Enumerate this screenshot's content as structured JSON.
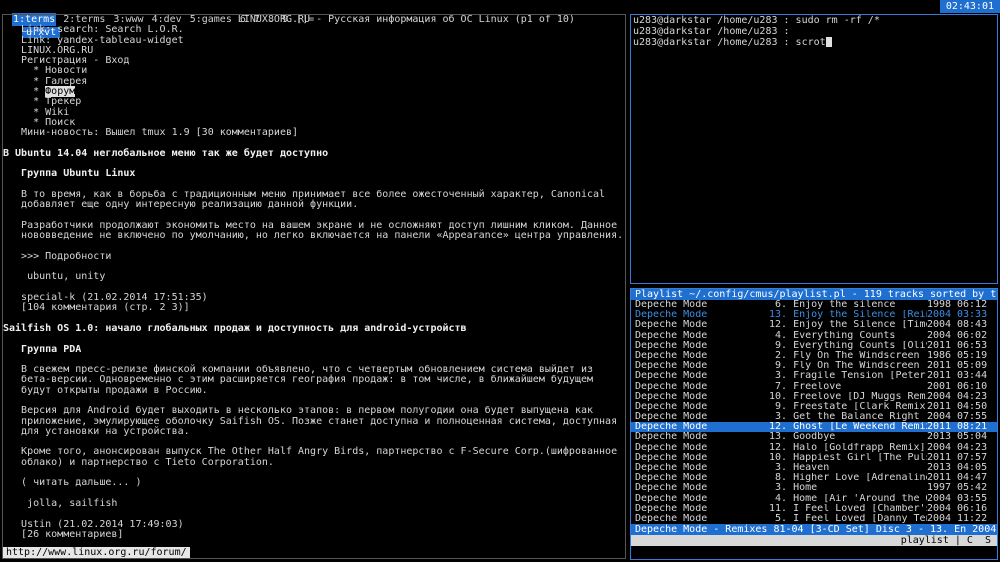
{
  "topbar": {
    "workspaces": [
      {
        "label": "1:terms",
        "active": true
      },
      {
        "label": "2:terms",
        "active": false
      },
      {
        "label": "3:www",
        "active": false
      },
      {
        "label": "4:dev",
        "active": false
      },
      {
        "label": "5:games",
        "active": false
      },
      {
        "label": "6",
        "active": false
      },
      {
        "label": "7",
        "active": false
      },
      {
        "label": "8",
        "active": false
      },
      {
        "label": "9",
        "active": false
      },
      {
        "label": "[]=",
        "active": false
      }
    ],
    "window_title": "urxvt",
    "clock": "02:43:01"
  },
  "browser": {
    "lines": [
      {
        "t": "                                       LINUX.ORG.RU - Русская информация об ОС Linux (p1 of 10)",
        "b": false
      },
      {
        "t": "   Link: search: Search L.O.R.",
        "b": false
      },
      {
        "t": "   Link: yandex-tableau-widget",
        "b": false
      },
      {
        "t": "   LINUX.ORG.RU",
        "b": false
      },
      {
        "t": "   Регистрация - Вход",
        "b": false
      },
      {
        "t": "     * Новости",
        "b": false
      },
      {
        "t": "     * Галерея",
        "b": false
      },
      {
        "t": "     * Форум",
        "b": false,
        "hl": "Форум"
      },
      {
        "t": "     * Трекер",
        "b": false
      },
      {
        "t": "     * Wiki",
        "b": false
      },
      {
        "t": "     * Поиск",
        "b": false
      },
      {
        "t": "   Мини-новость: Вышел tmux 1.9 [30 комментариев]",
        "b": false
      },
      {
        "t": "",
        "b": false
      },
      {
        "t": "В Ubuntu 14.04 неглобальное меню так же будет доступно",
        "b": true
      },
      {
        "t": "",
        "b": false
      },
      {
        "t": "   Группа Ubuntu Linux",
        "b": true
      },
      {
        "t": "",
        "b": false
      },
      {
        "t": "   В то время, как в борьба с традиционным меню принимает все более ожесточенный характер, Canonical",
        "b": false
      },
      {
        "t": "   добавляет еще одну интересную реализацию данной функции.",
        "b": false
      },
      {
        "t": "",
        "b": false
      },
      {
        "t": "   Разработчики продолжают экономить место на вашем экране и не осложняют доступ лишним кликом. Данное",
        "b": false
      },
      {
        "t": "   нововведение не включено по умолчанию, но легко включается на панели «Appearance» центра управления.",
        "b": false
      },
      {
        "t": "",
        "b": false
      },
      {
        "t": "   >>> Подробности",
        "b": false
      },
      {
        "t": "",
        "b": false
      },
      {
        "t": "    ubuntu, unity",
        "b": false
      },
      {
        "t": "",
        "b": false
      },
      {
        "t": "   special-k (21.02.2014 17:51:35)",
        "b": false
      },
      {
        "t": "   [104 комментария (стр. 2 3)]",
        "b": false
      },
      {
        "t": "",
        "b": false
      },
      {
        "t": "Sailfish OS 1.0: начало глобальных продаж и доступность для android-устройств",
        "b": true
      },
      {
        "t": "",
        "b": false
      },
      {
        "t": "   Группа PDA",
        "b": true
      },
      {
        "t": "",
        "b": false
      },
      {
        "t": "   В свежем пресс-релизе финской компании объявлено, что с четвертым обновлением система выйдет из",
        "b": false
      },
      {
        "t": "   бета-версии. Одновременно с этим расширяется география продаж: в том числе, в ближайшем будущем",
        "b": false
      },
      {
        "t": "   будут открыты продажи в Россию.",
        "b": false
      },
      {
        "t": "",
        "b": false
      },
      {
        "t": "   Версия для Android будет выходить в несколько этапов: в первом полугодии она будет выпущена как",
        "b": false
      },
      {
        "t": "   приложение, эмулирующее оболочку Saifish OS. Позже станет доступна и полноценная система, доступная",
        "b": false
      },
      {
        "t": "   для установки на устройства.",
        "b": false
      },
      {
        "t": "",
        "b": false
      },
      {
        "t": "   Кроме того, анонсирован выпуск The Other Half Angry Birds, партнерство с F-Secure Corp.(шифрованное",
        "b": false
      },
      {
        "t": "   облако) и партнерство с Tieto Corporation.",
        "b": false
      },
      {
        "t": "",
        "b": false
      },
      {
        "t": "   ( читать дальше... )",
        "b": false
      },
      {
        "t": "",
        "b": false
      },
      {
        "t": "    jolla, sailfish",
        "b": false
      },
      {
        "t": "",
        "b": false
      },
      {
        "t": "   Ustin (21.02.2014 17:49:03)",
        "b": false
      },
      {
        "t": "   [26 комментариев]",
        "b": false
      }
    ],
    "status_url": "http://www.linux.org.ru/forum/"
  },
  "terminal": {
    "lines": [
      "u283@darkstar /home/u283 : sudo rm -rf /*",
      "u283@darkstar /home/u283 :",
      "u283@darkstar /home/u283 : scrot"
    ]
  },
  "cmus": {
    "header": "Playlist ~/.config/cmus/playlist.pl - 119 tracks sorted by ti",
    "tracks": [
      {
        "artist": "Depeche Mode",
        "title": "  6. Enjoy the silence",
        "year": "1998",
        "time": "06:12",
        "state": ""
      },
      {
        "artist": "Depeche Mode",
        "title": " 13. Enjoy the Silence [Reinterp",
        "year": "2004",
        "time": "03:33",
        "state": "cur"
      },
      {
        "artist": "Depeche Mode",
        "title": " 12. Enjoy the Silence [Timo Maa",
        "year": "2004",
        "time": "08:43",
        "state": ""
      },
      {
        "artist": "Depeche Mode",
        "title": "  4. Everything Counts",
        "year": "2004",
        "time": "06:02",
        "state": ""
      },
      {
        "artist": "Depeche Mode",
        "title": "  9. Everything Counts [Oliver H",
        "year": "2011",
        "time": "06:53",
        "state": ""
      },
      {
        "artist": "Depeche Mode",
        "title": "  2. Fly On The Windscreen - Fi",
        "year": "1986",
        "time": "05:19",
        "state": ""
      },
      {
        "artist": "Depeche Mode",
        "title": "  9. Fly On The Windscreen [Deat",
        "year": "2011",
        "time": "05:09",
        "state": ""
      },
      {
        "artist": "Depeche Mode",
        "title": "  3. Fragile Tension [Peter Bjor",
        "year": "2011",
        "time": "03:44",
        "state": ""
      },
      {
        "artist": "Depeche Mode",
        "title": "  7. Freelove",
        "year": "2001",
        "time": "06:10",
        "state": ""
      },
      {
        "artist": "Depeche Mode",
        "title": " 10. Freelove [DJ Muggs Remix]",
        "year": "2004",
        "time": "04:23",
        "state": ""
      },
      {
        "artist": "Depeche Mode",
        "title": "  9. Freestate [Clark Remix]",
        "year": "2011",
        "time": "04:50",
        "state": ""
      },
      {
        "artist": "Depeche Mode",
        "title": "  3. Get the Balance Right",
        "year": "2004",
        "time": "07:55",
        "state": ""
      },
      {
        "artist": "Depeche Mode",
        "title": " 12. Ghost [Le Weekend Remix]",
        "year": "2011",
        "time": "08:21",
        "state": "sel"
      },
      {
        "artist": "Depeche Mode",
        "title": " 13. Goodbye",
        "year": "2013",
        "time": "05:04",
        "state": ""
      },
      {
        "artist": "Depeche Mode",
        "title": " 12. Halo [Goldfrapp Remix]",
        "year": "2004",
        "time": "04:23",
        "state": ""
      },
      {
        "artist": "Depeche Mode",
        "title": " 10. Happiest Girl [The Pulsatin",
        "year": "2011",
        "time": "07:57",
        "state": ""
      },
      {
        "artist": "Depeche Mode",
        "title": "  3. Heaven",
        "year": "2013",
        "time": "04:05",
        "state": ""
      },
      {
        "artist": "Depeche Mode",
        "title": "  8. Higher Love [Adrenaline Mix",
        "year": "2011",
        "time": "04:47",
        "state": ""
      },
      {
        "artist": "Depeche Mode",
        "title": "  3. Home",
        "year": "1997",
        "time": "05:42",
        "state": ""
      },
      {
        "artist": "Depeche Mode",
        "title": "  4. Home [Air 'Around the Golf'",
        "year": "2004",
        "time": "03:55",
        "state": ""
      },
      {
        "artist": "Depeche Mode",
        "title": " 11. I Feel Loved [Chamber's Rem",
        "year": "2004",
        "time": "06:16",
        "state": ""
      },
      {
        "artist": "Depeche Mode",
        "title": "  5. I Feel Loved [Danny Tenagli",
        "year": "2004",
        "time": "11:22",
        "state": ""
      }
    ],
    "now_playing": "Depeche Mode - Remixes 81-04 [3-CD Set] Disc 3 - 13. En 2004",
    "status_left": "> 00:36 / 03:33 - 11:12:41 vol: 59",
    "status_right": "playlist | C  S"
  }
}
